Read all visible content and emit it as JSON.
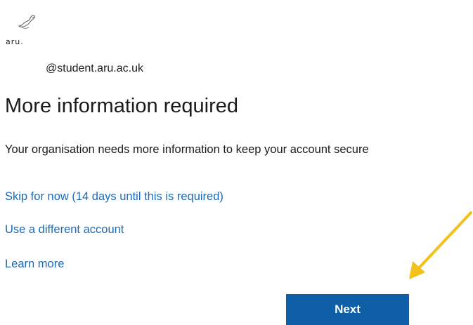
{
  "logo": {
    "text": "aru.",
    "icon": "swan-icon"
  },
  "account": {
    "email_domain": "@student.aru.ac.uk"
  },
  "page": {
    "title": "More information required",
    "description": "Your organisation needs more information to keep your account secure"
  },
  "links": {
    "skip": "Skip for now (14 days until this is required)",
    "different_account": "Use a different account",
    "learn_more": "Learn more"
  },
  "buttons": {
    "next": "Next"
  },
  "colors": {
    "link": "#1a6bb8",
    "primary_button": "#0e5ea8",
    "annotation_arrow": "#f2c21b"
  }
}
